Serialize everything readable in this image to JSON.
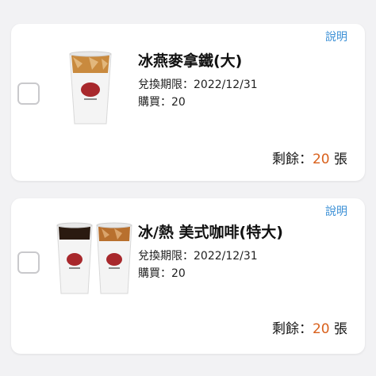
{
  "items": [
    {
      "help_label": "說明",
      "title": "冰燕麥拿鐵(大)",
      "expiry_label": "兌換期限：",
      "expiry_value": "2022/12/31",
      "purchased_label": "購買：",
      "purchased_value": "20",
      "remaining_label": "剩餘：",
      "remaining_count": "20",
      "remaining_unit": "張",
      "icon": "iced-latte-cup-icon"
    },
    {
      "help_label": "說明",
      "title": "冰/熱 美式咖啡(特大)",
      "expiry_label": "兌換期限：",
      "expiry_value": "2022/12/31",
      "purchased_label": "購買：",
      "purchased_value": "20",
      "remaining_label": "剩餘：",
      "remaining_count": "20",
      "remaining_unit": "張",
      "icon": "americano-cups-icon"
    }
  ],
  "colors": {
    "link": "#3a8fd6",
    "remaining_count": "#d9601b",
    "background": "#f2f2f4"
  }
}
